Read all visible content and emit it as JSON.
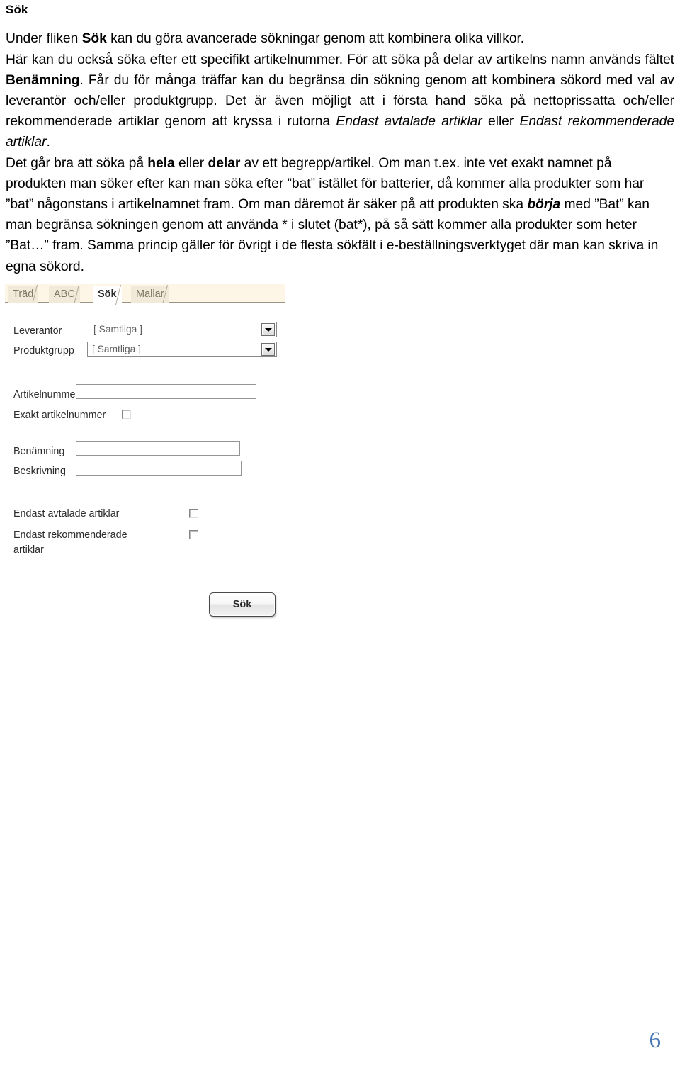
{
  "document": {
    "title": "Sök",
    "paragraph_lines": [
      {
        "id": "l1",
        "runs": [
          {
            "text": "Under fliken ",
            "style": "normal"
          },
          {
            "text": "Sök",
            "style": "bold"
          },
          {
            "text": " kan du göra avancerade sökningar genom att kombinera olika villkor.",
            "style": "normal"
          }
        ]
      },
      {
        "id": "l2",
        "runs": [
          {
            "text": "Här kan du också söka efter ett specifikt artikelnummer. För att söka på delar av artikelns namn används fältet ",
            "style": "normal"
          },
          {
            "text": "Benämning",
            "style": "bold"
          },
          {
            "text": ". Får du för många träffar kan du begränsa din sökning genom att kombinera sökord med val av leverantör och/eller produktgrupp. Det är även möjligt att i första hand söka på nettoprissatta och/eller rekommenderade artiklar genom att kryssa i rutorna ",
            "style": "normal"
          },
          {
            "text": "Endast avtalade artiklar",
            "style": "italic"
          },
          {
            "text": " eller ",
            "style": "normal"
          },
          {
            "text": "Endast rekommenderade artiklar",
            "style": "italic"
          },
          {
            "text": ".",
            "style": "normal"
          }
        ]
      },
      {
        "id": "l3",
        "runs": [
          {
            "text": "Det går bra att söka på ",
            "style": "normal"
          },
          {
            "text": "hela",
            "style": "bold"
          },
          {
            "text": " eller ",
            "style": "normal"
          },
          {
            "text": "delar",
            "style": "bold"
          },
          {
            "text": " av ett begrepp/artikel. Om man t.ex. inte vet exakt namnet på produkten man söker efter kan man söka efter ”bat” istället för batterier, då kommer alla produkter som har ”bat” någonstans i artikelnamnet fram. Om man däremot är säker på att produkten ska ",
            "style": "normal"
          },
          {
            "text": "börja",
            "style": "bold-italic"
          },
          {
            "text": " med ”Bat” kan man begränsa sökningen genom att använda * i slutet (bat*), på så sätt kommer alla produkter som heter ”Bat…” fram. Samma princip gäller för övrigt i de flesta sökfält i e-beställningsverktyget där man kan skriva in egna sökord.",
            "style": "normal"
          }
        ]
      }
    ],
    "page_number": "6"
  },
  "app": {
    "tabs": [
      {
        "label": "Träd",
        "active": false
      },
      {
        "label": "ABC",
        "active": false
      },
      {
        "label": "Sök",
        "active": true
      },
      {
        "label": "Mallar",
        "active": false
      }
    ],
    "fields": {
      "leverantor_label": "Leverantör",
      "leverantor_value": "[ Samtliga ]",
      "produktgrupp_label": "Produktgrupp",
      "produktgrupp_value": "[ Samtliga ]",
      "artikelnummer_label": "Artikelnummer",
      "artikelnummer_value": "",
      "exakt_artikelnummer_label": "Exakt artikelnummer",
      "exakt_artikelnummer_checked": false,
      "benamning_label": "Benämning",
      "benamning_value": "",
      "beskrivning_label": "Beskrivning",
      "beskrivning_value": "",
      "endast_avtalade_label": "Endast avtalade artiklar",
      "endast_avtalade_checked": false,
      "endast_rekommenderade_label_line1": "Endast rekommenderade",
      "endast_rekommenderade_label_line2": "artiklar",
      "endast_rekommenderade_checked": false
    },
    "search_button_label": "Sök",
    "colors": {
      "tabstrip_bg": "#fdf6e6",
      "tab_inactive_bg": "#f1ead8",
      "tab_inactive_text": "#7d7669",
      "tab_active_bg": "#ffffff",
      "tab_active_text": "#2b2b2b",
      "tabstrip_border": "#9b9384",
      "page_number": "#4a7ab5"
    }
  }
}
